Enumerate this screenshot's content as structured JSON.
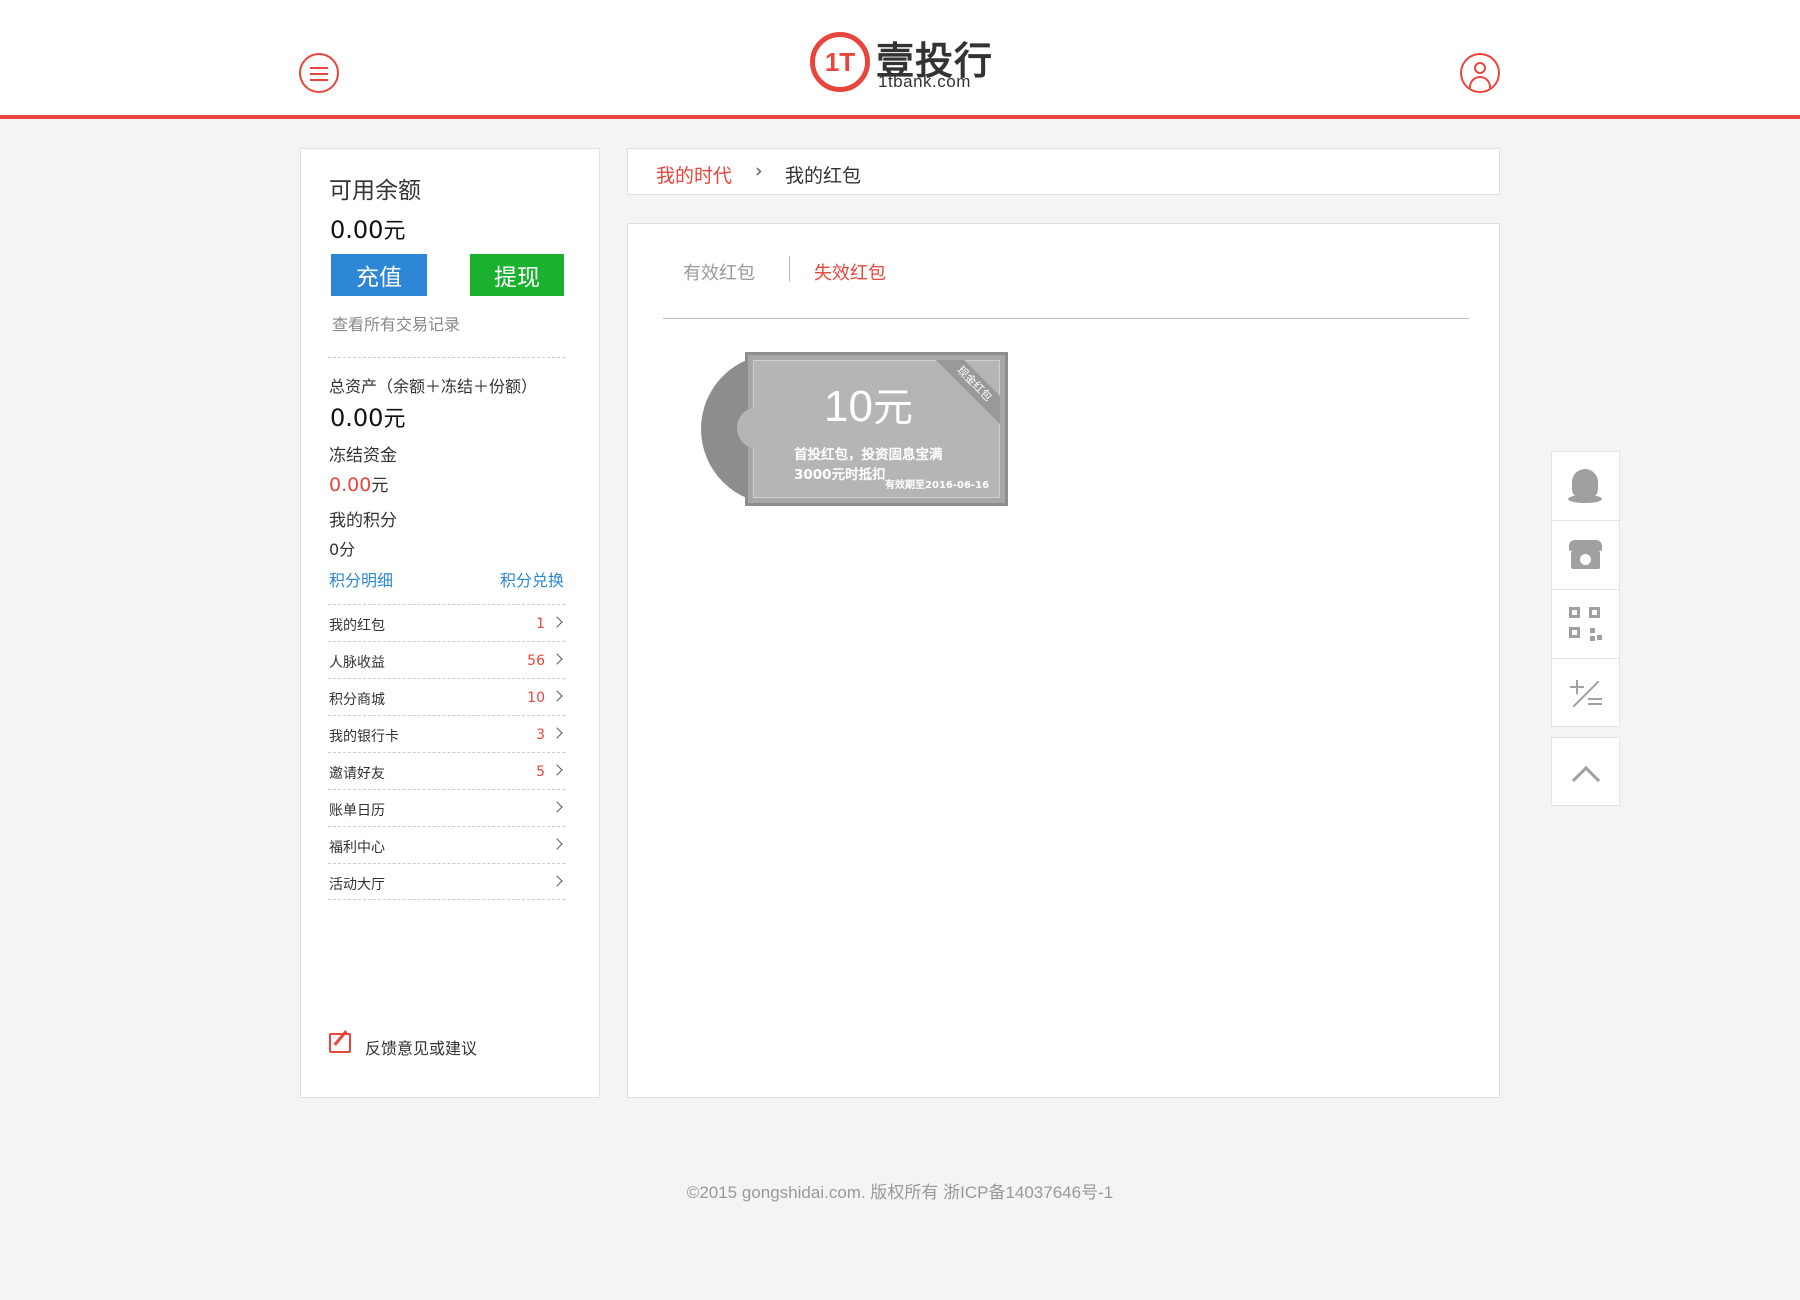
{
  "header": {
    "logo_mark": "1T",
    "logo_cn": "壹投行",
    "logo_en": "1tbank.com"
  },
  "sidebar": {
    "balance_label": "可用余额",
    "balance_value": "0.00",
    "balance_unit": "元",
    "recharge_label": "充值",
    "withdraw_label": "提现",
    "records_link": "查看所有交易记录",
    "total_label": "总资产（余额＋冻结＋份额）",
    "total_value": "0.00",
    "total_unit": "元",
    "frozen_label": "冻结资金",
    "frozen_value": "0.00",
    "frozen_unit": "元",
    "points_label": "我的积分",
    "points_value": "0分",
    "points_detail_link": "积分明细",
    "points_exchange_link": "积分兑换",
    "items": [
      {
        "label": "我的红包",
        "count": "1"
      },
      {
        "label": "人脉收益",
        "count": "56"
      },
      {
        "label": " 积分商城",
        "count": "10"
      },
      {
        "label": "我的银行卡",
        "count": "3"
      },
      {
        "label": "邀请好友",
        "count": "5"
      },
      {
        "label": "账单日历",
        "count": ""
      },
      {
        "label": "福利中心",
        "count": ""
      },
      {
        "label": "活动大厅",
        "count": ""
      }
    ],
    "feedback_label": "反馈意见或建议"
  },
  "breadcrumb": {
    "home": "我的时代",
    "separator": "›",
    "current": "我的红包"
  },
  "tabs": {
    "valid": "有效红包",
    "invalid": "失效红包",
    "active": "invalid"
  },
  "coupon": {
    "amount": "10",
    "unit": "元",
    "ribbon": "现金红包",
    "desc_line1": "首投红包，投资固息宝满",
    "desc_line2": "3000元时抵扣",
    "expiry": "有效期至2016-06-16"
  },
  "float_toolbar": [
    "qq-icon",
    "phone-icon",
    "qr-code-icon",
    "calculator-icon",
    "back-to-top-icon"
  ],
  "footer": {
    "copyright": "©2015 gongshidai.com. 版权所有 浙ICP备14037646号-1"
  },
  "colors": {
    "accent": "#e8463c",
    "recharge": "#2d86d6",
    "withdraw": "#19b12e",
    "link": "#2d86d6"
  }
}
